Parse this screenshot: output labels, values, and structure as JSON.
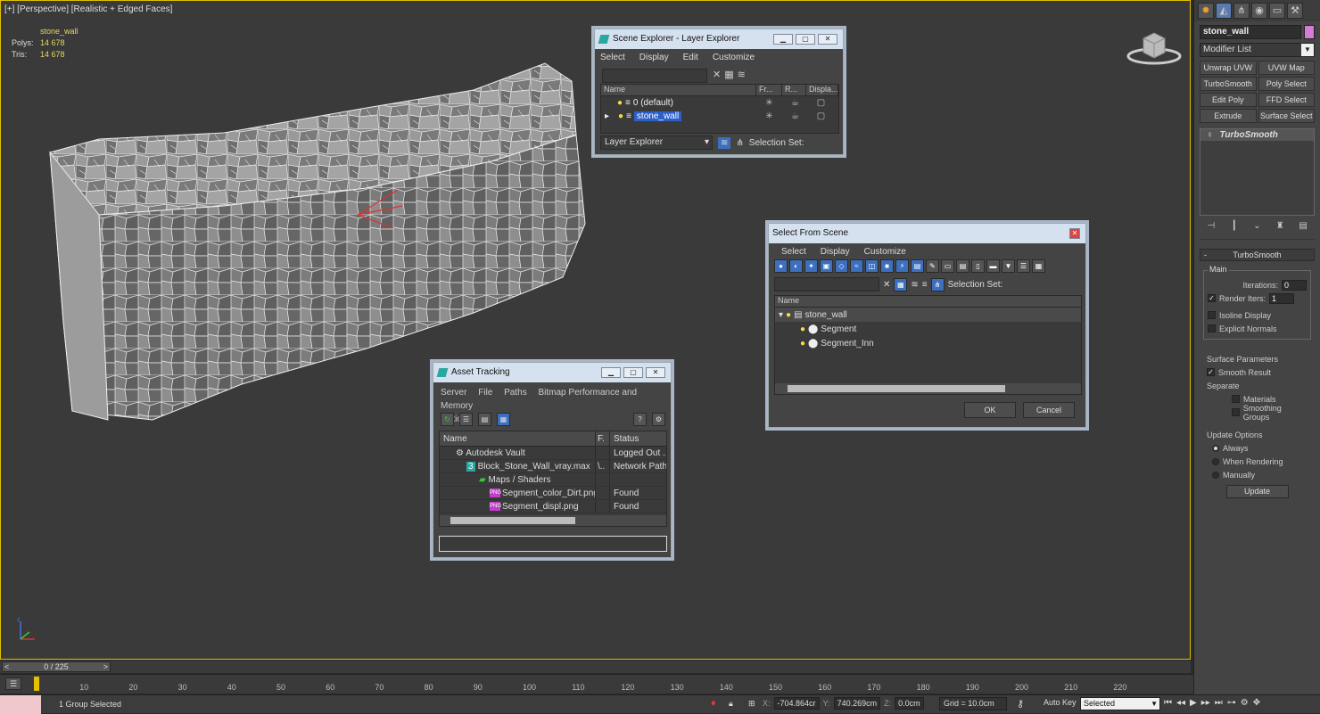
{
  "viewport": {
    "label": "[+] [Perspective] [Realistic + Edged Faces]",
    "object_name": "stone_wall",
    "polys_label": "Polys:",
    "polys_value": "14 678",
    "tris_label": "Tris:",
    "tris_value": "14 678"
  },
  "scene_explorer": {
    "title": "Scene Explorer - Layer Explorer",
    "menu": [
      "Select",
      "Display",
      "Edit",
      "Customize"
    ],
    "columns": [
      "Name",
      "Fr...",
      "R...",
      "Displa..."
    ],
    "rows": [
      {
        "name": "0 (default)",
        "selected": false
      },
      {
        "name": "stone_wall",
        "selected": true
      }
    ],
    "footer_dropdown": "Layer Explorer",
    "selection_set_label": "Selection Set:"
  },
  "select_from_scene": {
    "title": "Select From Scene",
    "menu": [
      "Select",
      "Display",
      "Customize"
    ],
    "selection_set_label": "Selection Set:",
    "column": "Name",
    "rows": [
      {
        "name": "stone_wall"
      },
      {
        "name": "Segment"
      },
      {
        "name": "Segment_Inn"
      }
    ],
    "ok": "OK",
    "cancel": "Cancel"
  },
  "asset_tracking": {
    "title": "Asset Tracking",
    "menu_line1": [
      "Server",
      "File",
      "Paths",
      "Bitmap Performance and Memory"
    ],
    "menu_line2": [
      "Options"
    ],
    "columns": [
      "Name",
      "F.",
      "Status"
    ],
    "rows": [
      {
        "name": "Autodesk Vault",
        "f": "",
        "status": "Logged Out ..."
      },
      {
        "name": "Block_Stone_Wall_vray.max",
        "f": "\\..",
        "status": "Network Path"
      },
      {
        "name": "Maps / Shaders",
        "f": "",
        "status": ""
      },
      {
        "name": "Segment_color_Dirt.png",
        "f": "",
        "status": "Found"
      },
      {
        "name": "Segment_displ.png",
        "f": "",
        "status": "Found"
      }
    ]
  },
  "command_panel": {
    "object_name": "stone_wall",
    "object_color": "#d57bd8",
    "modifier_list": "Modifier List",
    "modifier_buttons": [
      "Unwrap UVW",
      "UVW Map",
      "TurboSmooth",
      "Poly Select",
      "Edit Poly",
      "FFD Select",
      "Extrude",
      "Surface Select"
    ],
    "stack_item": "TurboSmooth",
    "rollout_title": "TurboSmooth",
    "main_group": "Main",
    "iterations_label": "Iterations:",
    "iterations_value": "0",
    "render_iters_label": "Render Iters:",
    "render_iters_value": "1",
    "isoline_display": "Isoline Display",
    "explicit_normals": "Explicit Normals",
    "surface_group": "Surface Parameters",
    "smooth_result": "Smooth Result",
    "separate_label": "Separate",
    "materials": "Materials",
    "smoothing_groups": "Smoothing Groups",
    "update_group": "Update Options",
    "always": "Always",
    "when_rendering": "When Rendering",
    "manually": "Manually",
    "update_button": "Update"
  },
  "timeline": {
    "frame_display": "0 / 225",
    "ticks": [
      "10",
      "20",
      "30",
      "40",
      "50",
      "60",
      "70",
      "80",
      "90",
      "100",
      "110",
      "120",
      "130",
      "140",
      "150",
      "160",
      "170",
      "180",
      "190",
      "200",
      "210",
      "220"
    ]
  },
  "status": {
    "text": "1 Group Selected",
    "x_label": "X:",
    "x_value": "-704.864cr",
    "y_label": "Y:",
    "y_value": "740.269cm",
    "z_label": "Z:",
    "z_value": "0.0cm",
    "grid": "Grid = 10.0cm",
    "auto_key": "Auto Key",
    "selected_dropdown": "Selected"
  }
}
